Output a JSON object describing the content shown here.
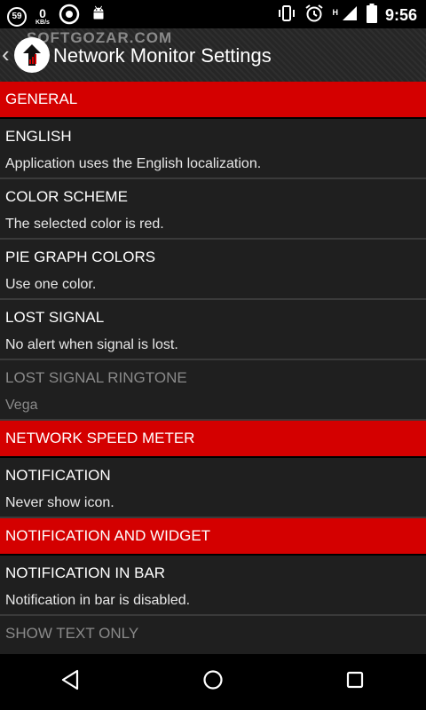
{
  "status_bar": {
    "badge": "59",
    "speed_value": "0",
    "speed_unit": "KB/s",
    "network_type": "H",
    "time": "9:56",
    "icons": [
      "circle-59-icon",
      "network-speed-icon",
      "app-circle-icon",
      "android-icon",
      "vibrate-icon",
      "alarm-icon",
      "signal-icon",
      "battery-icon"
    ]
  },
  "action_bar": {
    "watermark": "SOFTGOZAR.COM",
    "title": "Network Monitor Settings"
  },
  "sections": [
    {
      "title": "GENERAL",
      "items": [
        {
          "title": "ENGLISH",
          "summary": "Application uses the English localization."
        },
        {
          "title": "COLOR SCHEME",
          "summary": "The selected color is red."
        },
        {
          "title": "PIE GRAPH COLORS",
          "summary": "Use one color."
        },
        {
          "title": "LOST SIGNAL",
          "summary": "No alert when signal is lost."
        },
        {
          "title": "LOST SIGNAL RINGTONE",
          "summary": "Vega"
        }
      ]
    },
    {
      "title": "NETWORK SPEED METER",
      "items": [
        {
          "title": "NOTIFICATION",
          "summary": "Never show icon."
        }
      ]
    },
    {
      "title": "NOTIFICATION AND WIDGET",
      "items": [
        {
          "title": "NOTIFICATION IN BAR",
          "summary": "Notification in bar is disabled."
        },
        {
          "title": "SHOW TEXT ONLY",
          "summary": ""
        }
      ]
    }
  ],
  "colors": {
    "accent": "#d40000",
    "background": "#1f1f1f"
  }
}
